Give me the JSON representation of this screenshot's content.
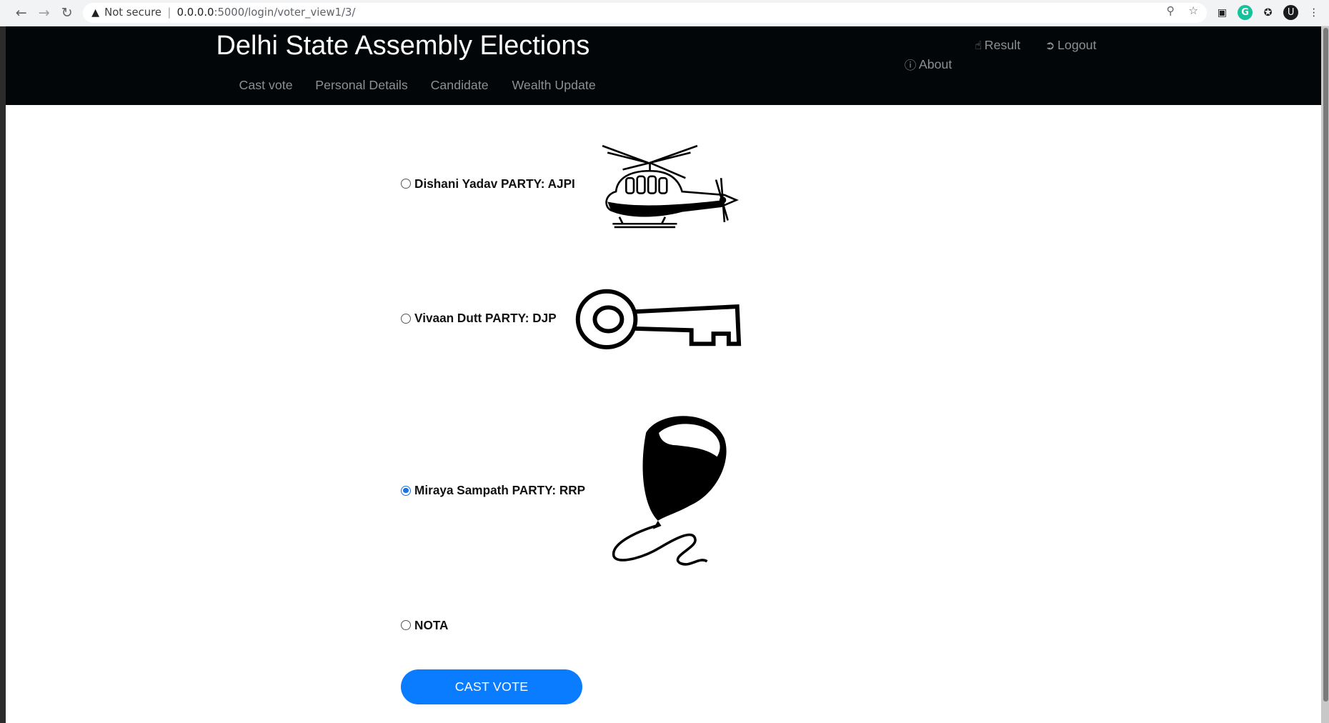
{
  "browser": {
    "security_label": "Not secure",
    "url_host": "0.0.0.0",
    "url_path": ":5000/login/voter_view1/3/",
    "profile_initial": "U"
  },
  "header": {
    "title": "Delhi State Assembly Elections",
    "nav": [
      "Cast vote",
      "Personal Details",
      "Candidate",
      "Wealth Update"
    ],
    "about_label": "About",
    "result_label": "Result",
    "logout_label": "Logout"
  },
  "ballot": {
    "candidates": [
      {
        "label": "Dishani Yadav PARTY: AJPI",
        "symbol": "helicopter-symbol",
        "selected": false
      },
      {
        "label": "Vivaan Dutt PARTY: DJP",
        "symbol": "key-symbol",
        "selected": false
      },
      {
        "label": "Miraya Sampath PARTY: RRP",
        "symbol": "balloon-symbol",
        "selected": true
      },
      {
        "label": "NOTA",
        "symbol": "",
        "selected": false
      }
    ],
    "submit_label": "CAST VOTE"
  },
  "colors": {
    "navbar_bg": "#030608",
    "nav_link": "#8d8f93",
    "button": "#0a7cff",
    "radio_selected": "#1a73e8"
  }
}
